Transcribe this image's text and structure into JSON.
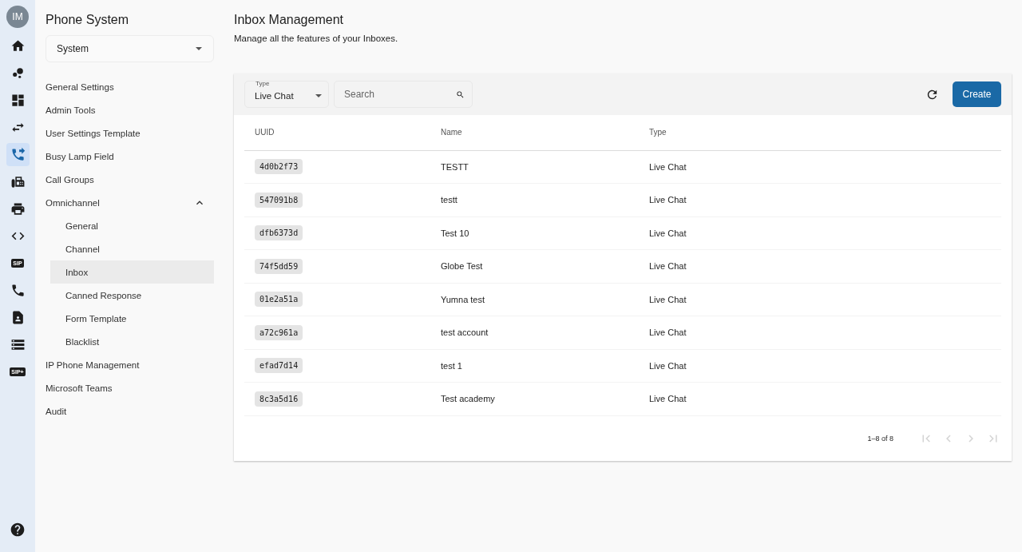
{
  "rail": {
    "avatar": "IM",
    "items": [
      {
        "kind": "home",
        "selected": false
      },
      {
        "kind": "hub",
        "selected": false
      },
      {
        "kind": "dashboard",
        "selected": false
      },
      {
        "kind": "swap",
        "selected": false
      },
      {
        "kind": "phone-forward",
        "selected": true
      },
      {
        "kind": "fax",
        "selected": false
      },
      {
        "kind": "printer",
        "selected": false
      },
      {
        "kind": "code",
        "selected": false
      },
      {
        "kind": "badge",
        "label": "SIP",
        "selected": false
      },
      {
        "kind": "phone",
        "selected": false
      },
      {
        "kind": "contact",
        "selected": false
      },
      {
        "kind": "storage",
        "selected": false
      },
      {
        "kind": "badge",
        "label": "SIP+",
        "selected": false
      }
    ]
  },
  "sidebar": {
    "title": "Phone System",
    "select": "System",
    "items": [
      {
        "label": "General Settings",
        "selected": false
      },
      {
        "label": "Admin Tools",
        "selected": false
      },
      {
        "label": "User Settings Template",
        "selected": false
      },
      {
        "label": "Busy Lamp Field",
        "selected": false
      },
      {
        "label": "Call Groups",
        "selected": false
      },
      {
        "label": "Omnichannel",
        "selected": false,
        "expanded": true,
        "children": [
          {
            "label": "General",
            "selected": false
          },
          {
            "label": "Channel",
            "selected": false
          },
          {
            "label": "Inbox",
            "selected": true
          },
          {
            "label": "Canned Response",
            "selected": false
          },
          {
            "label": "Form Template",
            "selected": false
          },
          {
            "label": "Blacklist",
            "selected": false
          }
        ]
      },
      {
        "label": "IP Phone Management",
        "selected": false
      },
      {
        "label": "Microsoft Teams",
        "selected": false
      },
      {
        "label": "Audit",
        "selected": false
      }
    ]
  },
  "page": {
    "title": "Inbox Management",
    "subtitle": "Manage all the features of your Inboxes."
  },
  "toolbar": {
    "type_label": "Type",
    "type_value": "Live Chat",
    "search_placeholder": "Search",
    "create": "Create"
  },
  "table": {
    "columns": [
      "UUID",
      "Name",
      "Type"
    ],
    "rows": [
      {
        "uuid": "4d0b2f73",
        "name": "TESTT",
        "type": "Live Chat"
      },
      {
        "uuid": "547091b8",
        "name": "testt",
        "type": "Live Chat"
      },
      {
        "uuid": "dfb6373d",
        "name": "Test 10",
        "type": "Live Chat"
      },
      {
        "uuid": "74f5dd59",
        "name": "Globe Test",
        "type": "Live Chat"
      },
      {
        "uuid": "01e2a51a",
        "name": "Yumna test",
        "type": "Live Chat"
      },
      {
        "uuid": "a72c961a",
        "name": "test account",
        "type": "Live Chat"
      },
      {
        "uuid": "efad7d14",
        "name": "test 1",
        "type": "Live Chat"
      },
      {
        "uuid": "8c3a5d16",
        "name": "Test academy",
        "type": "Live Chat"
      }
    ]
  },
  "pagination": {
    "range": "1–8 of 8",
    "first_disabled": true,
    "prev_disabled": true,
    "next_disabled": true,
    "last_disabled": true
  }
}
